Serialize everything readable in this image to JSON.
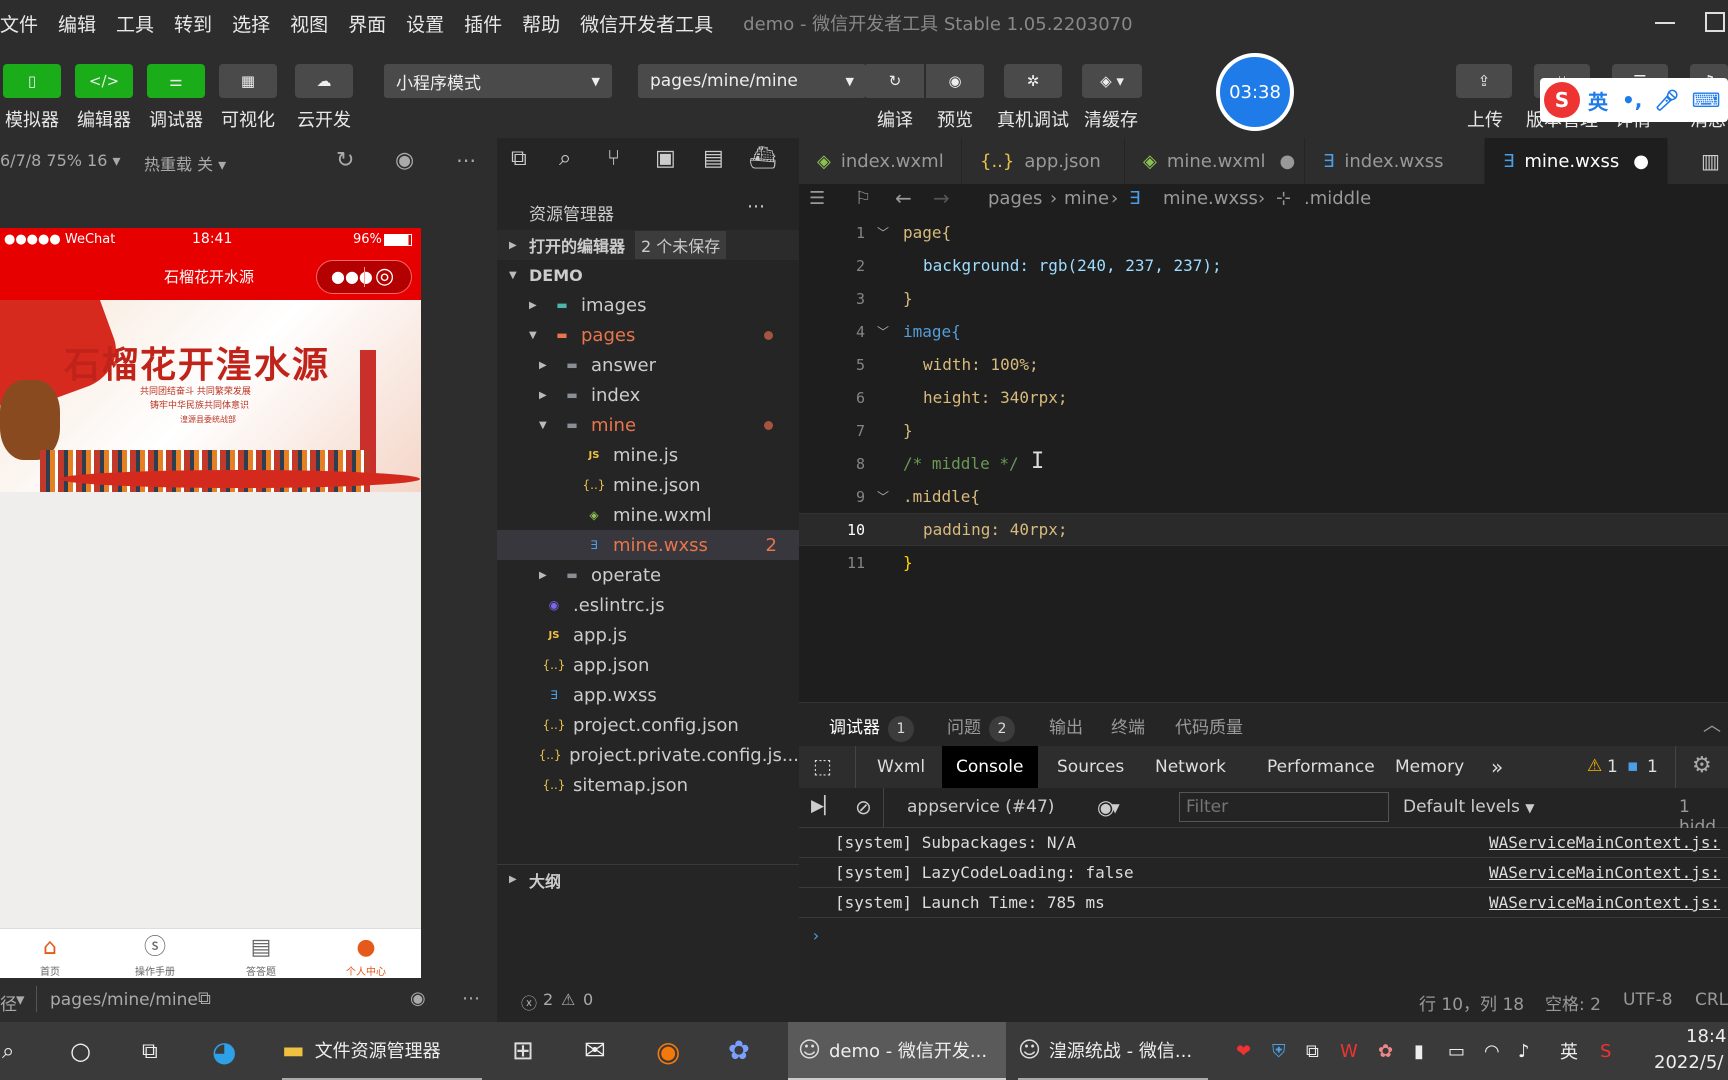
{
  "menubar": {
    "items": [
      "文件",
      "编辑",
      "工具",
      "转到",
      "选择",
      "视图",
      "界面",
      "设置",
      "插件",
      "帮助",
      "微信开发者工具"
    ],
    "window_title": "demo - 微信开发者工具 Stable 1.05.2203070"
  },
  "toolbar": {
    "buttons": [
      {
        "label": "模拟器",
        "icon": "phone-icon"
      },
      {
        "label": "编辑器",
        "icon": "code-icon"
      },
      {
        "label": "调试器",
        "icon": "sliders-icon"
      },
      {
        "label": "可视化",
        "icon": "layout-icon"
      },
      {
        "label": "云开发",
        "icon": "cloud-icon"
      }
    ],
    "mode_select": "小程序模式",
    "page_select": "pages/mine/mine",
    "compile": "编译",
    "preview": "预览",
    "remote_debug": "真机调试",
    "clear_cache": "清缓存",
    "upload": "上传",
    "version": "版本管理",
    "detail": "详情",
    "message": "消息"
  },
  "timer": "03:38",
  "ime": {
    "s": "S",
    "lang": "英",
    "punct": "•,"
  },
  "simulator": {
    "device": "6/7/8 75% 16",
    "hot_reload": "热重载 关",
    "status_carrier": "●●●●● WeChat",
    "status_time": "18:41",
    "status_battery": "96%",
    "nav_title": "石榴花开水源",
    "banner_title": "石榴花开湟水源",
    "banner_sub1": "共同团结奋斗 共同繁荣发展",
    "banner_sub2": "铸牢中华民族共同体意识",
    "banner_sub3": "湟源县委统战部",
    "tabs": [
      {
        "label": "首页",
        "icon": "home-icon"
      },
      {
        "label": "操作手册",
        "icon": "dollar-icon"
      },
      {
        "label": "答答题",
        "icon": "clipboard-icon"
      },
      {
        "label": "个人中心",
        "icon": "user-icon"
      }
    ],
    "path_prefix": "径",
    "path": "pages/mine/mine"
  },
  "explorer": {
    "title": "资源管理器",
    "open_editors": "打开的编辑器",
    "unsaved": "2 个未保存",
    "project": "DEMO",
    "outline": "大纲",
    "tree": [
      {
        "label": "images",
        "type": "folder-img"
      },
      {
        "label": "pages",
        "type": "folder-pages"
      },
      {
        "label": "answer",
        "type": "folder"
      },
      {
        "label": "index",
        "type": "folder"
      },
      {
        "label": "mine",
        "type": "folder"
      },
      {
        "label": "mine.js",
        "type": "js"
      },
      {
        "label": "mine.json",
        "type": "json"
      },
      {
        "label": "mine.wxml",
        "type": "wxml"
      },
      {
        "label": "mine.wxss",
        "type": "wxss",
        "count": "2"
      },
      {
        "label": "operate",
        "type": "folder"
      },
      {
        "label": ".eslintrc.js",
        "type": "eslint"
      },
      {
        "label": "app.js",
        "type": "js"
      },
      {
        "label": "app.json",
        "type": "json"
      },
      {
        "label": "app.wxss",
        "type": "wxss"
      },
      {
        "label": "project.config.json",
        "type": "json"
      },
      {
        "label": "project.private.config.js...",
        "type": "json"
      },
      {
        "label": "sitemap.json",
        "type": "json"
      }
    ],
    "errors": "2",
    "warnings": "0"
  },
  "editor_tabs": [
    {
      "label": "index.wxml"
    },
    {
      "label": "app.json"
    },
    {
      "label": "mine.wxml"
    },
    {
      "label": "index.wxss"
    },
    {
      "label": "mine.wxss"
    }
  ],
  "breadcrumb": {
    "a": "pages",
    "b": "mine",
    "c": "mine.wxss",
    "d": ".middle"
  },
  "code": [
    {
      "n": "1",
      "t": "page{"
    },
    {
      "n": "2",
      "t": "background: rgb(240, 237, 237);"
    },
    {
      "n": "3",
      "t": "}"
    },
    {
      "n": "4",
      "t": "image{"
    },
    {
      "n": "5",
      "t": "width: 100%;"
    },
    {
      "n": "6",
      "t": "height: 340rpx;"
    },
    {
      "n": "7",
      "t": "}"
    },
    {
      "n": "8",
      "t": "/* middle */"
    },
    {
      "n": "9",
      "t": ".middle{"
    },
    {
      "n": "10",
      "t": "padding: 40rpx;"
    },
    {
      "n": "11",
      "t": "}"
    }
  ],
  "panel": {
    "debugger": "调试器",
    "debugger_count": "1",
    "problems": "问题",
    "problems_count": "2",
    "output": "输出",
    "terminal": "终端",
    "quality": "代码质量"
  },
  "devtools": {
    "tabs": [
      "Wxml",
      "Console",
      "Sources",
      "Network",
      "Performance",
      "Memory"
    ],
    "more": "»",
    "warn": "1",
    "info": "1",
    "context": "appservice (#47)",
    "filter_placeholder": "Filter",
    "levels": "Default levels",
    "hidden": "1 hidd"
  },
  "console": [
    {
      "msg": "[system] Subpackages: N/A",
      "src": "WAServiceMainContext.js:"
    },
    {
      "msg": "[system] LazyCodeLoading: false",
      "src": "WAServiceMainContext.js:"
    },
    {
      "msg": "[system] Launch Time: 785 ms",
      "src": "WAServiceMainContext.js:"
    }
  ],
  "statusbar": {
    "position": "行 10，列 18",
    "spaces": "空格: 2",
    "encoding": "UTF-8",
    "eol": "CRL"
  },
  "taskbar": {
    "explorer": "文件资源管理器",
    "demo": "demo - 微信开发...",
    "wechat": "湟源统战 - 微信...",
    "lang": "英",
    "time": "18:4",
    "date": "2022/5/"
  }
}
